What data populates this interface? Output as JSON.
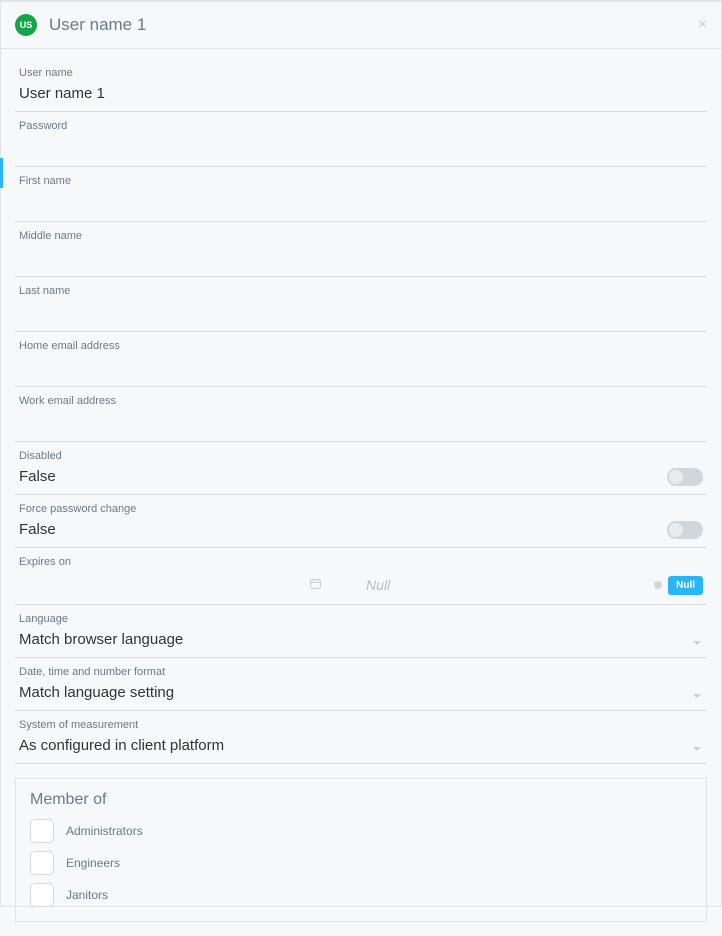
{
  "header": {
    "avatar_text": "US",
    "title": "User name 1"
  },
  "fields": {
    "username": {
      "label": "User name",
      "value": "User name 1"
    },
    "password": {
      "label": "Password",
      "value": ""
    },
    "first_name": {
      "label": "First name",
      "value": ""
    },
    "middle_name": {
      "label": "Middle name",
      "value": ""
    },
    "last_name": {
      "label": "Last name",
      "value": ""
    },
    "home_email": {
      "label": "Home email address",
      "value": ""
    },
    "work_email": {
      "label": "Work email address",
      "value": ""
    },
    "disabled": {
      "label": "Disabled",
      "value": "False"
    },
    "force_pw": {
      "label": "Force password change",
      "value": "False"
    },
    "expires": {
      "label": "Expires on",
      "value": "Null",
      "pill": "Null"
    },
    "language": {
      "label": "Language",
      "value": "Match browser language"
    },
    "dtformat": {
      "label": "Date, time and number format",
      "value": "Match language setting"
    },
    "measurement": {
      "label": "System of measurement",
      "value": "As configured in client platform"
    }
  },
  "groups": {
    "title": "Member of",
    "items": [
      "Administrators",
      "Engineers",
      "Janitors"
    ]
  }
}
